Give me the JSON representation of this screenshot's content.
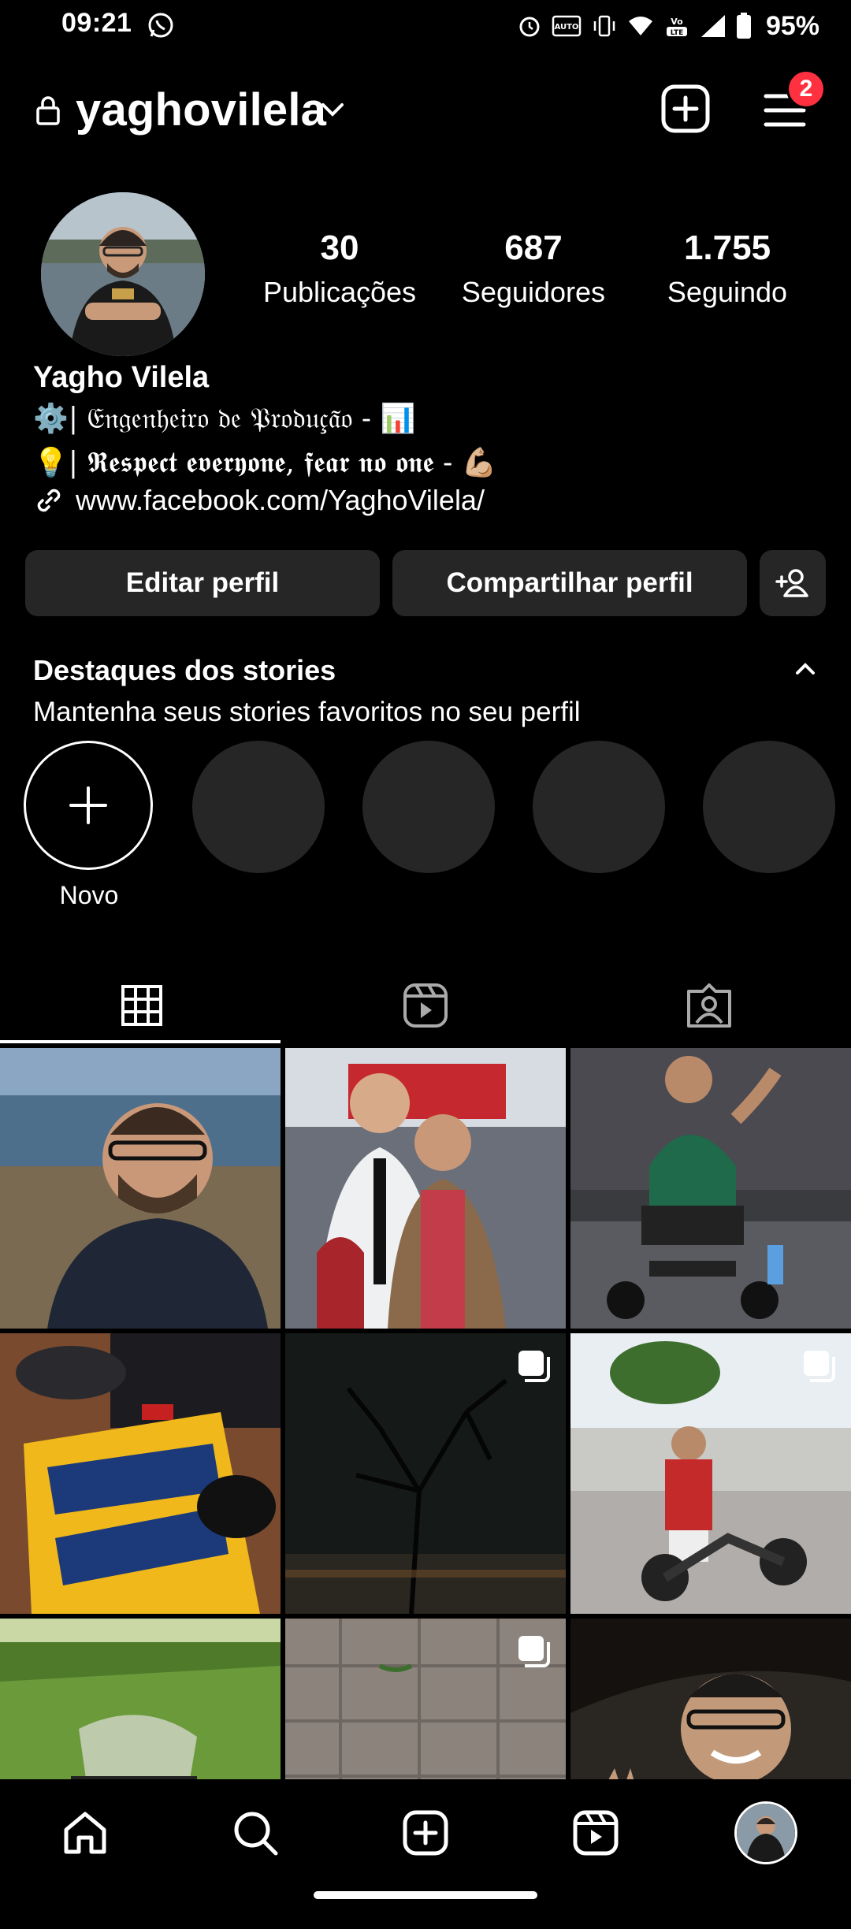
{
  "status_bar": {
    "time": "09:21",
    "battery": "95%",
    "icons": [
      "whatsapp-icon",
      "alarm-icon",
      "auto-hd-icon",
      "vibrate-icon",
      "wifi-icon",
      "volte-icon",
      "signal-icon",
      "battery-icon"
    ]
  },
  "header": {
    "username": "yaghovilela",
    "notification_count": "2"
  },
  "profile": {
    "stats": [
      {
        "value": "30",
        "label": "Publicações"
      },
      {
        "value": "687",
        "label": "Seguidores"
      },
      {
        "value": "1.755",
        "label": "Seguindo"
      }
    ],
    "name": "Yagho Vilela",
    "bio_line1": "⚙️| 𝔈𝔫𝔤𝔢𝔫𝔥𝔢𝔦𝔯𝔬 𝔡𝔢 𝔓𝔯𝔬𝔡𝔲𝔠̧𝔞̃𝔬 - 📊",
    "bio_line2": "💡| 𝕽𝖊𝖘𝖕𝖊𝖈𝖙 𝖊𝖛𝖊𝖗𝖞𝖔𝖓𝖊, 𝖋𝖊𝖆𝖗 𝖓𝖔 𝖔𝖓𝖊 - 💪🏼",
    "link": "www.facebook.com/YaghoVilela/"
  },
  "actions": {
    "edit": "Editar perfil",
    "share": "Compartilhar perfil"
  },
  "highlights": {
    "title": "Destaques dos stories",
    "subtitle": "Mantenha seus stories favoritos no seu perfil",
    "new_label": "Novo"
  },
  "tabs": [
    "grid-icon",
    "reels-icon",
    "tagged-icon"
  ],
  "posts": [
    {
      "name": "post-selfie-river",
      "multi": false
    },
    {
      "name": "post-two-men-hall",
      "multi": false
    },
    {
      "name": "post-gym-bike",
      "multi": false
    },
    {
      "name": "post-book-desk",
      "multi": false
    },
    {
      "name": "post-tree-night",
      "multi": true
    },
    {
      "name": "post-motorcycle",
      "multi": true
    },
    {
      "name": "post-grass-field",
      "multi": false
    },
    {
      "name": "post-pavement-shoe",
      "multi": true
    },
    {
      "name": "post-selfie-cave",
      "multi": false
    }
  ],
  "bottom_nav": [
    "home-icon",
    "search-icon",
    "create-icon",
    "reels-icon",
    "profile-avatar"
  ]
}
